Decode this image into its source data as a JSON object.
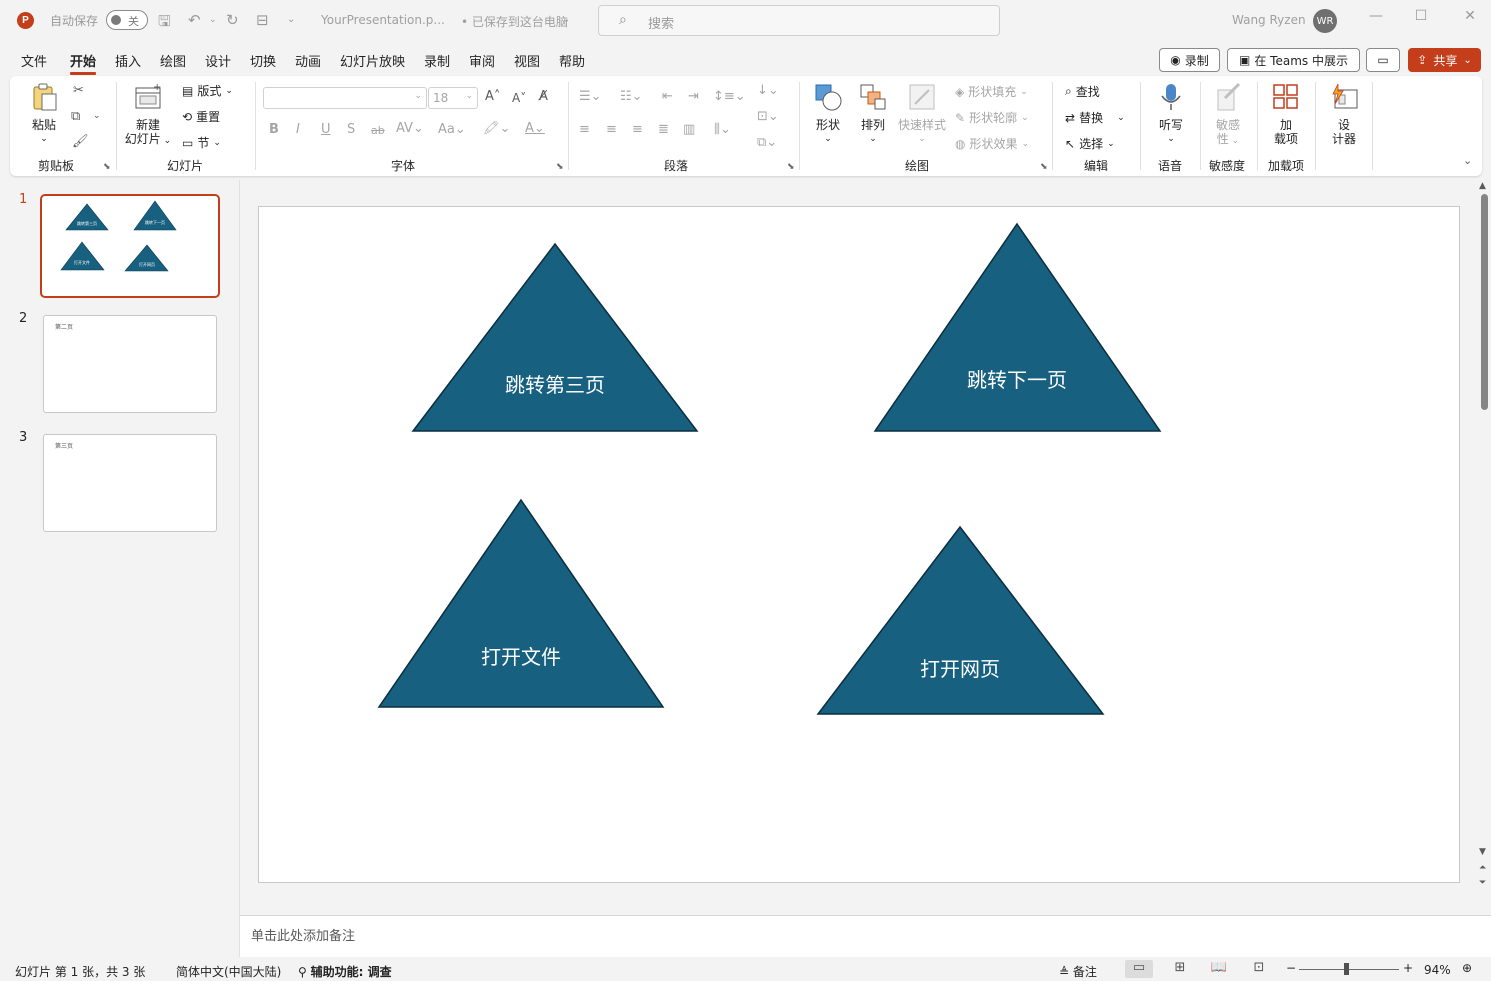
{
  "titlebar": {
    "logo": "P",
    "autosave_label": "自动保存",
    "autosave_state": "关",
    "file_name": "YourPresentation.p...",
    "save_status": "• 已保存到这台电脑",
    "search_placeholder": "搜索",
    "user_name": "Wang Ryzen",
    "user_initials": "WR"
  },
  "menu": {
    "items": [
      "文件",
      "开始",
      "插入",
      "绘图",
      "设计",
      "切换",
      "动画",
      "幻灯片放映",
      "录制",
      "审阅",
      "视图",
      "帮助"
    ],
    "active": "开始",
    "record_label": "录制",
    "teams_label": "在 Teams 中展示",
    "share_label": "共享"
  },
  "ribbon": {
    "clipboard": {
      "paste": "粘贴",
      "label": "剪贴板"
    },
    "slides": {
      "new_slide_1": "新建",
      "new_slide_2": "幻灯片",
      "layout": "版式",
      "reset": "重置",
      "section": "节",
      "label": "幻灯片"
    },
    "font": {
      "font_size": "18",
      "label": "字体"
    },
    "paragraph": {
      "label": "段落"
    },
    "drawing": {
      "shapes": "形状",
      "arrange": "排列",
      "quick_styles": "快速样式",
      "shape_fill": "形状填充",
      "shape_outline": "形状轮廓",
      "shape_effects": "形状效果",
      "label": "绘图"
    },
    "editing": {
      "find": "查找",
      "replace": "替换",
      "select": "选择",
      "label": "编辑"
    },
    "voice": {
      "dictate": "听写",
      "label": "语音"
    },
    "sensitivity": {
      "btn_1": "敏感",
      "btn_2": "性",
      "label": "敏感度"
    },
    "addins": {
      "btn_1": "加",
      "btn_2": "载项",
      "label": "加载项"
    },
    "designer": {
      "btn_1": "设",
      "btn_2": "计器"
    }
  },
  "thumbnails": [
    {
      "num": "1",
      "text": ""
    },
    {
      "num": "2",
      "text": "第二页"
    },
    {
      "num": "3",
      "text": "第三页"
    }
  ],
  "thumb1_labels": [
    "跳转第三页",
    "跳转下一页",
    "打开文件",
    "打开网页"
  ],
  "slide": {
    "shape_color": "#17607f",
    "shapes": [
      "跳转第三页",
      "跳转下一页",
      "打开文件",
      "打开网页"
    ]
  },
  "notes_placeholder": "单击此处添加备注",
  "status": {
    "slide_info": "幻灯片 第 1 张，共 3 张",
    "language": "简体中文(中国大陆)",
    "accessibility_bold": "辅助功能: 调查",
    "notes": "备注",
    "zoom": "94%"
  },
  "colors": {
    "accent": "#c43e1c",
    "shape_fill": "#17607f"
  }
}
